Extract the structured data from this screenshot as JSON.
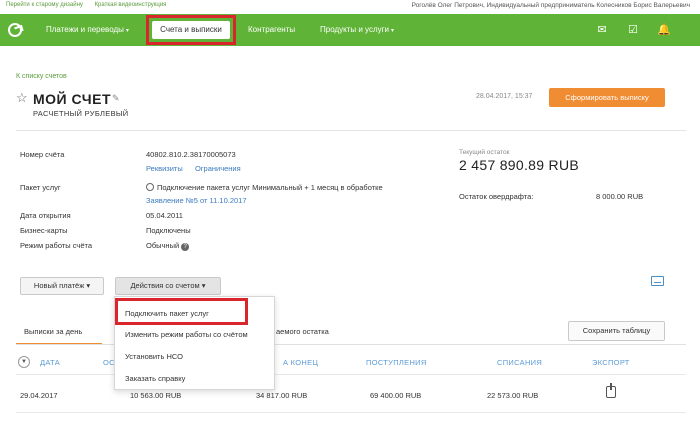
{
  "topbar": {
    "old_design": "Перейти к старому дизайну",
    "video": "Краткая видеоинструкция",
    "user": "Роголёв Олег Петрович, Индивидуальный предприниматель Колесников Борис Валерьевич"
  },
  "nav": {
    "payments": "Платежи и переводы",
    "accounts": "Счета и выписки",
    "contractors": "Контрагенты",
    "products": "Продукты и услуги"
  },
  "page": {
    "back_link": "К списку счетов",
    "title": "МОЙ СЧЕТ",
    "subtitle": "РАСЧЕТНЫЙ РУБЛЕВЫЙ",
    "date": "28.04.2017, 15:37",
    "generate_btn": "Сформировать выписку"
  },
  "details": {
    "account_label": "Номер счёта",
    "account_value": "40802.810.2.38170005073",
    "req_link": "Реквизиты",
    "limits_link": "Ограничения",
    "package_label": "Пакет услуг",
    "package_value": "Подключение пакета услуг Минимальный + 1 месяц в обработке",
    "package_link": "Заявление №5 от 11.10.2017",
    "open_label": "Дата открытия",
    "open_value": "05.04.2011",
    "cards_label": "Бизнес-карты",
    "cards_value": "Подключены",
    "mode_label": "Режим работы счёта",
    "mode_value": "Обычный"
  },
  "balance": {
    "label": "Текущий остаток",
    "value": "2 457 890.89 RUB",
    "overdraft_label": "Остаток овердрафта:",
    "overdraft_value": "8 000.00 RUB"
  },
  "actions": {
    "new_payment": "Новый платёж",
    "account_actions": "Действия со счетом"
  },
  "dropdown": {
    "items": [
      "Подключить пакет услуг",
      "Изменить режим работы со счётом",
      "Установить НСО",
      "Заказать справку"
    ]
  },
  "tabs": {
    "daily": "Выписки за день",
    "balance_partial": "аемого остатка",
    "save_table": "Сохранить таблицу"
  },
  "table": {
    "headers": {
      "date": "ДАТА",
      "start_partial": "ОС",
      "end_partial": "А КОНЕЦ",
      "income": "ПОСТУПЛЕНИЯ",
      "outcome": "СПИСАНИЯ",
      "export": "ЭКСПОРТ"
    },
    "rows": [
      {
        "date": "29.04.2017",
        "start": "10 563.00 RUB",
        "end": "34 817.00 RUB",
        "income": "69 400.00 RUB",
        "outcome": "22 573.00 RUB"
      }
    ]
  },
  "colors": {
    "brand_green": "#5fb336",
    "accent_orange": "#f08c32",
    "highlight_red": "#d9262c",
    "link_blue": "#3b7bbf"
  }
}
